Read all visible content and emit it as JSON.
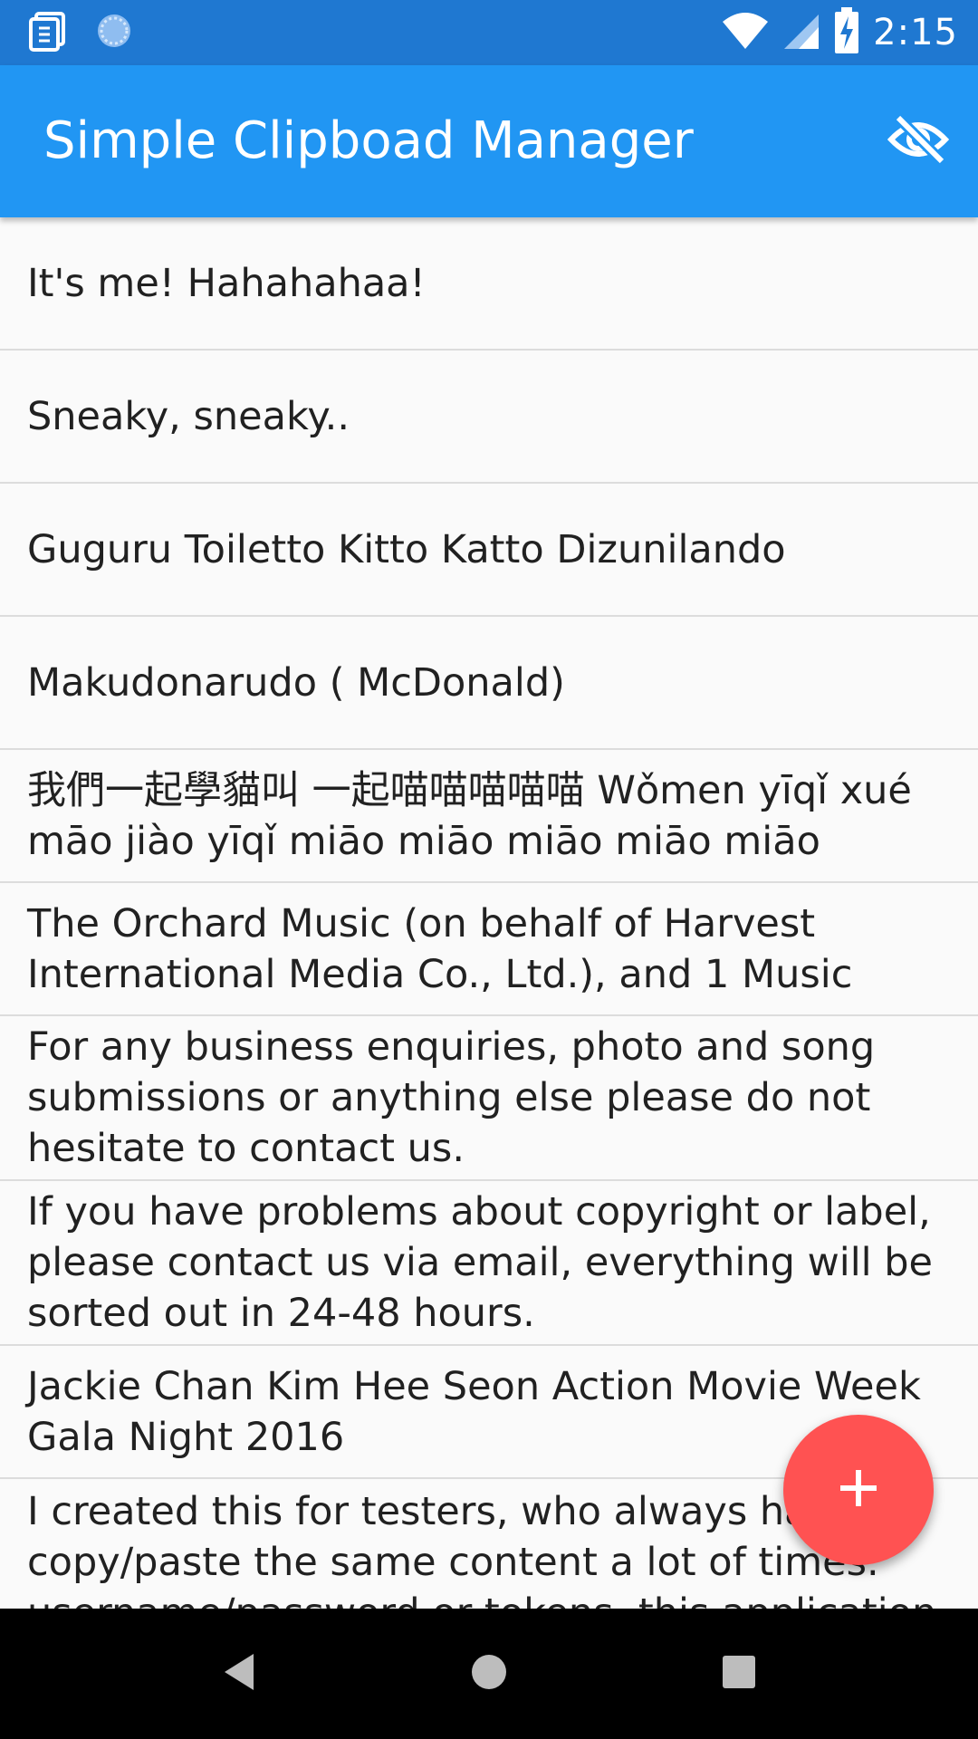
{
  "status_bar": {
    "time": "2:15",
    "icons": [
      "clipboard-notification-icon",
      "sync-icon",
      "wifi-icon",
      "cell-signal-icon",
      "battery-charging-icon"
    ]
  },
  "app_bar": {
    "title": "Simple Clipboad Manager",
    "action_icon": "visibility-off-icon"
  },
  "clips": [
    {
      "text": "It's me! Hahahahaa!"
    },
    {
      "text": "Sneaky, sneaky.."
    },
    {
      "text": "Guguru Toiletto Kitto Katto Dizunilando"
    },
    {
      "text": "Makudonarudo ( McDonald)"
    },
    {
      "text": "我們一起學貓叫 一起喵喵喵喵喵 Wǒmen yīqǐ xué māo jiào yīqǐ miāo miāo miāo miāo miāo"
    },
    {
      "text": "The Orchard Music (on behalf of Harvest International Media Co., Ltd.), and 1 Music"
    },
    {
      "text": "For any business enquiries, photo and song submissions or anything else please do not hesitate to contact us."
    },
    {
      "text": "If you have problems about copyright or label, please contact us via email, everything will be sorted out in 24-48 hours."
    },
    {
      "text": "Jackie Chan Kim Hee Seon Action Movie Week Gala Night 2016"
    },
    {
      "text": "I created this for testers, who always have to copy/paste the same content a lot of times. username/password or tokens, this application"
    }
  ],
  "fab": {
    "icon": "add-icon",
    "color": "#ff5252"
  },
  "nav_bar": {
    "icons": [
      "back-icon",
      "home-icon",
      "recents-icon"
    ]
  },
  "colors": {
    "primary": "#2196f3",
    "status_bar": "#1f78d1",
    "accent": "#ff5252"
  }
}
